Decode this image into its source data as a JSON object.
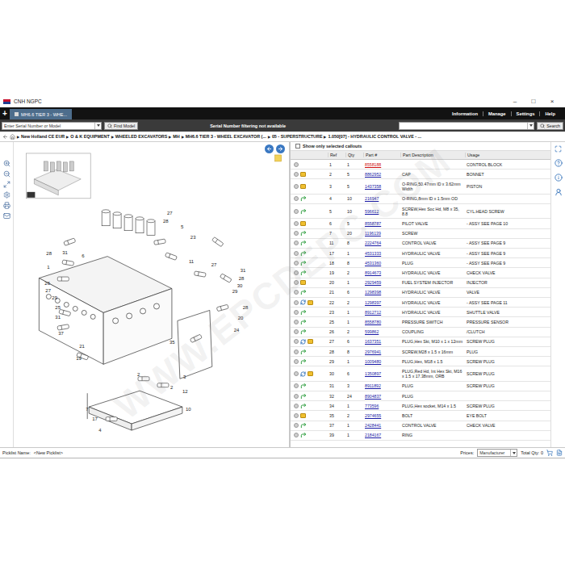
{
  "window": {
    "title": "CNH NGPC",
    "controls": [
      "–",
      "□",
      "×"
    ]
  },
  "new_tab": "+",
  "tabs": [
    {
      "label": "MH6.6 TIER 3 - WHE...",
      "selected": true
    }
  ],
  "menu": [
    "Information",
    "Manage",
    "Settings",
    "Help"
  ],
  "toolbar": {
    "serial_placeholder": "Enter Serial Number or Model",
    "find_button": "Find Model",
    "notice": "Serial Number filtering not available",
    "search_button": "Search"
  },
  "breadcrumb": {
    "separator": "▶",
    "items": [
      "New Holland CE EUR",
      "O & K EQUIPMENT",
      "WHEELED EXCAVATORS",
      "MH",
      "MH6.6 TIER 3 - WHEEL EXCAVATOR (...",
      "05 - SUPERSTRUCTURE",
      "1.050[07] - HYDRAULIC CONTROL VALVE - ..."
    ]
  },
  "diagram": {
    "callouts": [
      "27",
      "28",
      "5",
      "23",
      "11",
      "27",
      "31",
      "28",
      "30",
      "29",
      "28",
      "31",
      "6",
      "1",
      "26",
      "27",
      "29",
      "25",
      "31",
      "37",
      "21",
      "19",
      "28",
      "20",
      "24",
      "35",
      "2",
      "2",
      "3",
      "7",
      "17",
      "4",
      "10",
      "12"
    ]
  },
  "watermark": "WWW.EPCDEPC.COM",
  "parts": {
    "filter": {
      "label": "Show only selected callouts",
      "checked": false
    },
    "columns": [
      "Ref",
      "Qty",
      "Part #",
      "Part Description",
      "Usage"
    ],
    "rows": [
      {
        "ref": "1",
        "qty": "1",
        "part": "8558188",
        "description": "",
        "usage": "CONTROL BLOCK",
        "kind": "plain",
        "color": "#d01010"
      },
      {
        "ref": "2",
        "qty": "5",
        "part": "8862952",
        "description": "CAP",
        "usage": "BONNET",
        "kind": "box",
        "color": "#1a1aa6"
      },
      {
        "ref": "3",
        "qty": "5",
        "part": "1437358",
        "description": "O-RING,50.47mm ID x 3.62mm Width",
        "usage": "PISTON",
        "kind": "box",
        "color": "#1a1aa6"
      },
      {
        "ref": "4",
        "qty": "10",
        "part": "216947",
        "description": "O-RING,8mm ID x 1.5mm OD",
        "usage": "",
        "kind": "arrow",
        "color": "#1a1aa6"
      },
      {
        "ref": "5",
        "qty": "10",
        "part": "596612",
        "description": "SCREW,Hex Soc Hd, M8 x 35, 8.8",
        "usage": "CYL.HEAD SCREW",
        "kind": "arrow",
        "color": "#1a1aa6"
      },
      {
        "ref": "6",
        "qty": "5",
        "part": "8558787",
        "description": "PILOT VALVE",
        "usage": "- ASSY SEE PAGE 10",
        "kind": "box",
        "color": "#1a1aa6"
      },
      {
        "ref": "7",
        "qty": "20",
        "part": "1196139",
        "description": "SCREW",
        "usage": "",
        "kind": "arrow",
        "color": "#1a1aa6"
      },
      {
        "ref": "11",
        "qty": "8",
        "part": "2224764",
        "description": "CONTROL VALVE",
        "usage": "- ASSY SEE PAGE 9",
        "kind": "arrow",
        "color": "#1a1aa6"
      },
      {
        "ref": "17",
        "qty": "1",
        "part": "4531333",
        "description": "HYDRAULIC VALVE",
        "usage": "- ASSY SEE PAGE 9",
        "kind": "arrow",
        "color": "#1a1aa6"
      },
      {
        "ref": "18",
        "qty": "8",
        "part": "4531360",
        "description": "PLUG",
        "usage": "- ASSY SEE PAGE 9",
        "kind": "arrow",
        "color": "#1a1aa6"
      },
      {
        "ref": "19",
        "qty": "2",
        "part": "8914673",
        "description": "HYDRAULIC VALVE",
        "usage": "CHECK VALVE",
        "kind": "arrow",
        "color": "#1a1aa6"
      },
      {
        "ref": "20",
        "qty": "1",
        "part": "2929459",
        "description": "FUEL SYSTEM INJECTOR",
        "usage": "INJECTOR",
        "kind": "box",
        "color": "#1a1aa6"
      },
      {
        "ref": "21",
        "qty": "6",
        "part": "1298398",
        "description": "HYDRAULIC VALVE",
        "usage": "VALVE",
        "kind": "arrow",
        "color": "#1a1aa6"
      },
      {
        "ref": "22",
        "qty": "2",
        "part": "1298397",
        "description": "HYDRAULIC VALVE",
        "usage": "- ASSY SEE PAGE 11",
        "kind": "arrow-box",
        "color": "#1a1aa6"
      },
      {
        "ref": "23",
        "qty": "1",
        "part": "8912712",
        "description": "HYDRAULIC VALVE",
        "usage": "SHUTTLE VALVE",
        "kind": "arrow",
        "color": "#1a1aa6"
      },
      {
        "ref": "25",
        "qty": "1",
        "part": "8558780",
        "description": "PRESSURE SWITCH",
        "usage": "PRESSURE SENSOR",
        "kind": "arrow",
        "color": "#1a1aa6"
      },
      {
        "ref": "26",
        "qty": "2",
        "part": "599862",
        "description": "COUPLING",
        "usage": "/CLUTCH",
        "kind": "arrow",
        "color": "#1a1aa6"
      },
      {
        "ref": "27",
        "qty": "6",
        "part": "1637351",
        "description": "PLUG,Hex Skt, M10 x 1 x 12mm",
        "usage": "SCREW PLUG",
        "kind": "arrow-box",
        "color": "#1a1aa6"
      },
      {
        "ref": "28",
        "qty": "8",
        "part": "2976941",
        "description": "SCREW,M28 x 1.5 x 16mm",
        "usage": "PLUG",
        "kind": "arrow",
        "color": "#1a1aa6"
      },
      {
        "ref": "29",
        "qty": "1",
        "part": "1009480",
        "description": "PLUG,Hex, M18 x 1.5",
        "usage": "SCREW PLUG",
        "kind": "arrow",
        "color": "#1a1aa6"
      },
      {
        "ref": "30",
        "qty": "6",
        "part": "1350897",
        "description": "PLUG,Red Hd, Int Hex Skt, M16 x 1.5 x 17.38mm, ORB",
        "usage": "SCREW PLUG",
        "kind": "arrow-box",
        "color": "#1a1aa6"
      },
      {
        "ref": "31",
        "qty": "3",
        "part": "8911892",
        "description": "PLUG",
        "usage": "SCREW PLUG",
        "kind": "arrow",
        "color": "#1a1aa6"
      },
      {
        "ref": "32",
        "qty": "24",
        "part": "8904837",
        "description": "PLUG",
        "usage": "",
        "kind": "arrow",
        "color": "#1a1aa6"
      },
      {
        "ref": "34",
        "qty": "1",
        "part": "773596",
        "description": "PLUG,Hex socket, M14 x 1.5",
        "usage": "SCREW PLUG",
        "kind": "arrow",
        "color": "#1a1aa6"
      },
      {
        "ref": "35",
        "qty": "2",
        "part": "2974655",
        "description": "BOLT",
        "usage": "EYE BOLT",
        "kind": "box",
        "color": "#1a1aa6"
      },
      {
        "ref": "37",
        "qty": "1",
        "part": "2428441",
        "description": "CONTROL VALVE",
        "usage": "CHECK VALVE",
        "kind": "arrow",
        "color": "#1a1aa6"
      },
      {
        "ref": "39",
        "qty": "1",
        "part": "2184167",
        "description": "RING",
        "usage": "",
        "kind": "arrow",
        "color": "#1a1aa6"
      }
    ]
  },
  "status_bar": {
    "picklist_label": "Picklist Name:",
    "picklist_value": "<New Picklist>",
    "prices_label": "Prices:",
    "prices_value": "Manufacturer",
    "total": "Total Qty: 0"
  }
}
